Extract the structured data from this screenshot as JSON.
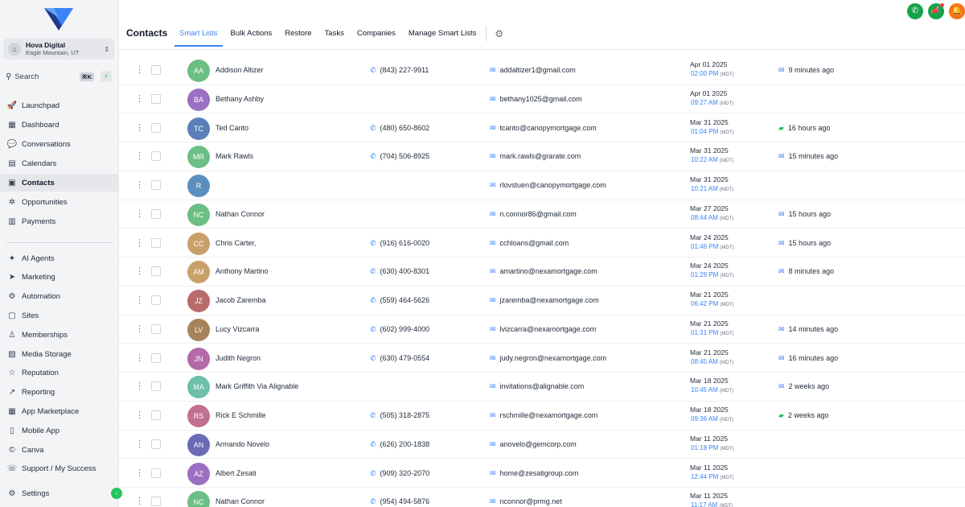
{
  "sidebar": {
    "account": {
      "name": "Hova Digital",
      "location": "Eagle Mountain, UT"
    },
    "search": {
      "label": "Search",
      "shortcut": "⌘K"
    },
    "nav_top": [
      {
        "label": "Launchpad",
        "icon": "rocket-icon",
        "glyph": "🚀"
      },
      {
        "label": "Dashboard",
        "icon": "dashboard-icon",
        "glyph": "▦"
      },
      {
        "label": "Conversations",
        "icon": "chat-icon",
        "glyph": "💬"
      },
      {
        "label": "Calendars",
        "icon": "calendar-icon",
        "glyph": "▤"
      },
      {
        "label": "Contacts",
        "icon": "contacts-icon",
        "glyph": "▣",
        "active": true
      },
      {
        "label": "Opportunities",
        "icon": "opportunities-icon",
        "glyph": "✲"
      },
      {
        "label": "Payments",
        "icon": "payments-icon",
        "glyph": "▥"
      }
    ],
    "nav_bottom": [
      {
        "label": "AI Agents",
        "icon": "sparkle-icon",
        "glyph": "✦"
      },
      {
        "label": "Marketing",
        "icon": "send-icon",
        "glyph": "➤"
      },
      {
        "label": "Automation",
        "icon": "automation-icon",
        "glyph": "⚙"
      },
      {
        "label": "Sites",
        "icon": "sites-icon",
        "glyph": "▢"
      },
      {
        "label": "Memberships",
        "icon": "memberships-icon",
        "glyph": "♙"
      },
      {
        "label": "Media Storage",
        "icon": "media-icon",
        "glyph": "▨"
      },
      {
        "label": "Reputation",
        "icon": "star-icon",
        "glyph": "☆"
      },
      {
        "label": "Reporting",
        "icon": "chart-icon",
        "glyph": "↗"
      },
      {
        "label": "App Marketplace",
        "icon": "marketplace-icon",
        "glyph": "▦"
      },
      {
        "label": "Mobile App",
        "icon": "mobile-icon",
        "glyph": "▯"
      },
      {
        "label": "Canva",
        "icon": "canva-icon",
        "glyph": "©"
      },
      {
        "label": "Support / My Success",
        "icon": "support-icon",
        "glyph": "☏"
      }
    ],
    "settings_label": "Settings"
  },
  "header": {
    "title": "Contacts",
    "tabs": [
      {
        "label": "Smart Lists",
        "active": true
      },
      {
        "label": "Bulk Actions"
      },
      {
        "label": "Restore"
      },
      {
        "label": "Tasks"
      },
      {
        "label": "Companies"
      },
      {
        "label": "Manage Smart Lists"
      }
    ]
  },
  "colors": {
    "accent": "#3b82f6",
    "phone_button": "#16a34a",
    "announce_button": "#16a34a",
    "notify_button": "#f97316"
  },
  "rows": [
    {
      "initials": "AA",
      "name": "Addison Altizer",
      "phone": "(843) 227-9911",
      "email": "addaltizer1@gmail.com",
      "date": "Apr 01 2025",
      "time": "02:00 PM",
      "tz": "(MDT)",
      "activity": "9 minutes ago",
      "activity_type": "email",
      "color": "#6cbf84"
    },
    {
      "initials": "BA",
      "name": "Bethany Ashby",
      "phone": "",
      "email": "bethany1025@gmail.com",
      "date": "Apr 01 2025",
      "time": "09:27 AM",
      "tz": "(MDT)",
      "activity": "",
      "activity_type": "",
      "color": "#9b6fc2"
    },
    {
      "initials": "TC",
      "name": "Ted Canto",
      "phone": "(480) 650-8602",
      "email": "tcanto@canopymortgage.com",
      "date": "Mar 31 2025",
      "time": "01:04 PM",
      "tz": "(MDT)",
      "activity": "16 hours ago",
      "activity_type": "sms",
      "color": "#5b7fb8"
    },
    {
      "initials": "MR",
      "name": "Mark Rawls",
      "phone": "(704) 506-8925",
      "email": "mark.rawls@grarate.com",
      "date": "Mar 31 2025",
      "time": "10:22 AM",
      "tz": "(MDT)",
      "activity": "15 minutes ago",
      "activity_type": "email",
      "color": "#6cbf84"
    },
    {
      "initials": "R",
      "name": "",
      "phone": "",
      "email": "rlovstuen@canopymortgage.com",
      "date": "Mar 31 2025",
      "time": "10:21 AM",
      "tz": "(MDT)",
      "activity": "",
      "activity_type": "",
      "color": "#5b8fbf"
    },
    {
      "initials": "NC",
      "name": "Nathan Connor",
      "phone": "",
      "email": "n.connor86@gmail.com",
      "date": "Mar 27 2025",
      "time": "08:44 AM",
      "tz": "(MDT)",
      "activity": "15 hours ago",
      "activity_type": "email",
      "color": "#6cbf84"
    },
    {
      "initials": "CC",
      "name": "Chris Carter,",
      "phone": "(916) 616-0020",
      "email": "cchloans@gmail.com",
      "date": "Mar 24 2025",
      "time": "01:46 PM",
      "tz": "(MDT)",
      "activity": "15 hours ago",
      "activity_type": "email",
      "color": "#c9a06a"
    },
    {
      "initials": "AM",
      "name": "Anthony Martino",
      "phone": "(630) 400-8301",
      "email": "amartino@nexamortgage.com",
      "date": "Mar 24 2025",
      "time": "01:29 PM",
      "tz": "(MDT)",
      "activity": "8 minutes ago",
      "activity_type": "email",
      "color": "#c9a06a"
    },
    {
      "initials": "JZ",
      "name": "Jacob Zaremba",
      "phone": "(559) 464-5626",
      "email": "jzaremba@nexamortgage.com",
      "date": "Mar 21 2025",
      "time": "06:42 PM",
      "tz": "(MDT)",
      "activity": "",
      "activity_type": "",
      "color": "#b96a6a"
    },
    {
      "initials": "LV",
      "name": "Lucy Vizcarra",
      "phone": "(602) 999-4000",
      "email": "lvizcarra@nexamortgage.com",
      "date": "Mar 21 2025",
      "time": "01:31 PM",
      "tz": "(MDT)",
      "activity": "14 minutes ago",
      "activity_type": "email",
      "color": "#a8835a"
    },
    {
      "initials": "JN",
      "name": "Judith Negron",
      "phone": "(630) 479-0554",
      "email": "judy.negron@nexamortgage.com",
      "date": "Mar 21 2025",
      "time": "08:45 AM",
      "tz": "(MDT)",
      "activity": "16 minutes ago",
      "activity_type": "email",
      "color": "#b56aa8"
    },
    {
      "initials": "MA",
      "name": "Mark Griffith Via Alignable",
      "phone": "",
      "email": "invitations@alignable.com",
      "date": "Mar 18 2025",
      "time": "10:45 AM",
      "tz": "(MDT)",
      "activity": "2 weeks ago",
      "activity_type": "email",
      "color": "#6cbfa8"
    },
    {
      "initials": "RS",
      "name": "Rick E Schmille",
      "phone": "(505) 318-2875",
      "email": "rschmille@nexamortgage.com",
      "date": "Mar 18 2025",
      "time": "09:36 AM",
      "tz": "(MDT)",
      "activity": "2 weeks ago",
      "activity_type": "sms",
      "color": "#c27090"
    },
    {
      "initials": "AN",
      "name": "Armando Novelo",
      "phone": "(626) 200-1838",
      "email": "anovelo@gemcorp.com",
      "date": "Mar 11 2025",
      "time": "01:18 PM",
      "tz": "(MDT)",
      "activity": "",
      "activity_type": "",
      "color": "#6a6ab5"
    },
    {
      "initials": "AZ",
      "name": "Albert Zesati",
      "phone": "(909) 320-2070",
      "email": "home@zesatigroup.com",
      "date": "Mar 11 2025",
      "time": "12:44 PM",
      "tz": "(MDT)",
      "activity": "",
      "activity_type": "",
      "color": "#9b6fc2"
    },
    {
      "initials": "NC",
      "name": "Nathan Connor",
      "phone": "(954) 494-5876",
      "email": "nconnor@prmg.net",
      "date": "Mar 11 2025",
      "time": "11:17 AM",
      "tz": "(MDT)",
      "activity": "",
      "activity_type": "",
      "color": "#6cbf84"
    }
  ]
}
